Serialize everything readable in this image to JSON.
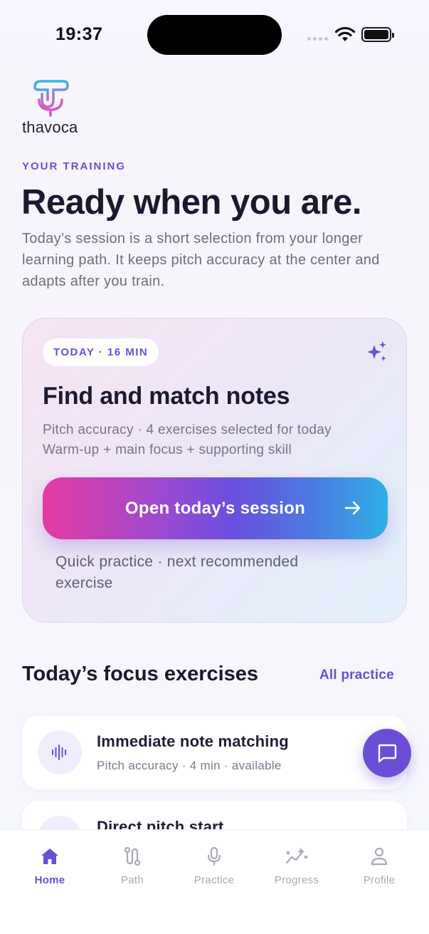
{
  "status": {
    "time": "19:37"
  },
  "brand": {
    "name": "thavoca"
  },
  "hero": {
    "eyebrow": "YOUR TRAINING",
    "headline": "Ready when you are.",
    "intro": "Today’s session is a short selection from your longer learning path. It keeps pitch accuracy at the center and adapts after you train."
  },
  "session": {
    "badge": "TODAY · 16 MIN",
    "title": "Find and match notes",
    "sub1": "Pitch accuracy · 4 exercises selected for today",
    "sub2": "Warm-up + main focus + supporting skill",
    "cta": "Open today’s session",
    "quick": "Quick practice · next recommended exercise"
  },
  "focus": {
    "title": "Today’s focus exercises",
    "link": "All practice",
    "items": [
      {
        "title": "Immediate note matching",
        "sub": "Pitch accuracy · 4 min · available",
        "icon": "waveform-icon"
      },
      {
        "title": "Direct pitch start",
        "sub": "",
        "icon": "waveform-icon"
      }
    ]
  },
  "tabs": [
    {
      "label": "Home",
      "icon": "home-icon",
      "active": true
    },
    {
      "label": "Path",
      "icon": "path-icon",
      "active": false
    },
    {
      "label": "Practice",
      "icon": "microphone-icon",
      "active": false
    },
    {
      "label": "Progress",
      "icon": "progress-icon",
      "active": false
    },
    {
      "label": "Profile",
      "icon": "profile-icon",
      "active": false
    }
  ],
  "colors": {
    "accent": "#6a4fd6",
    "gradient_start": "#e63aa0",
    "gradient_end": "#2fb0e6"
  }
}
